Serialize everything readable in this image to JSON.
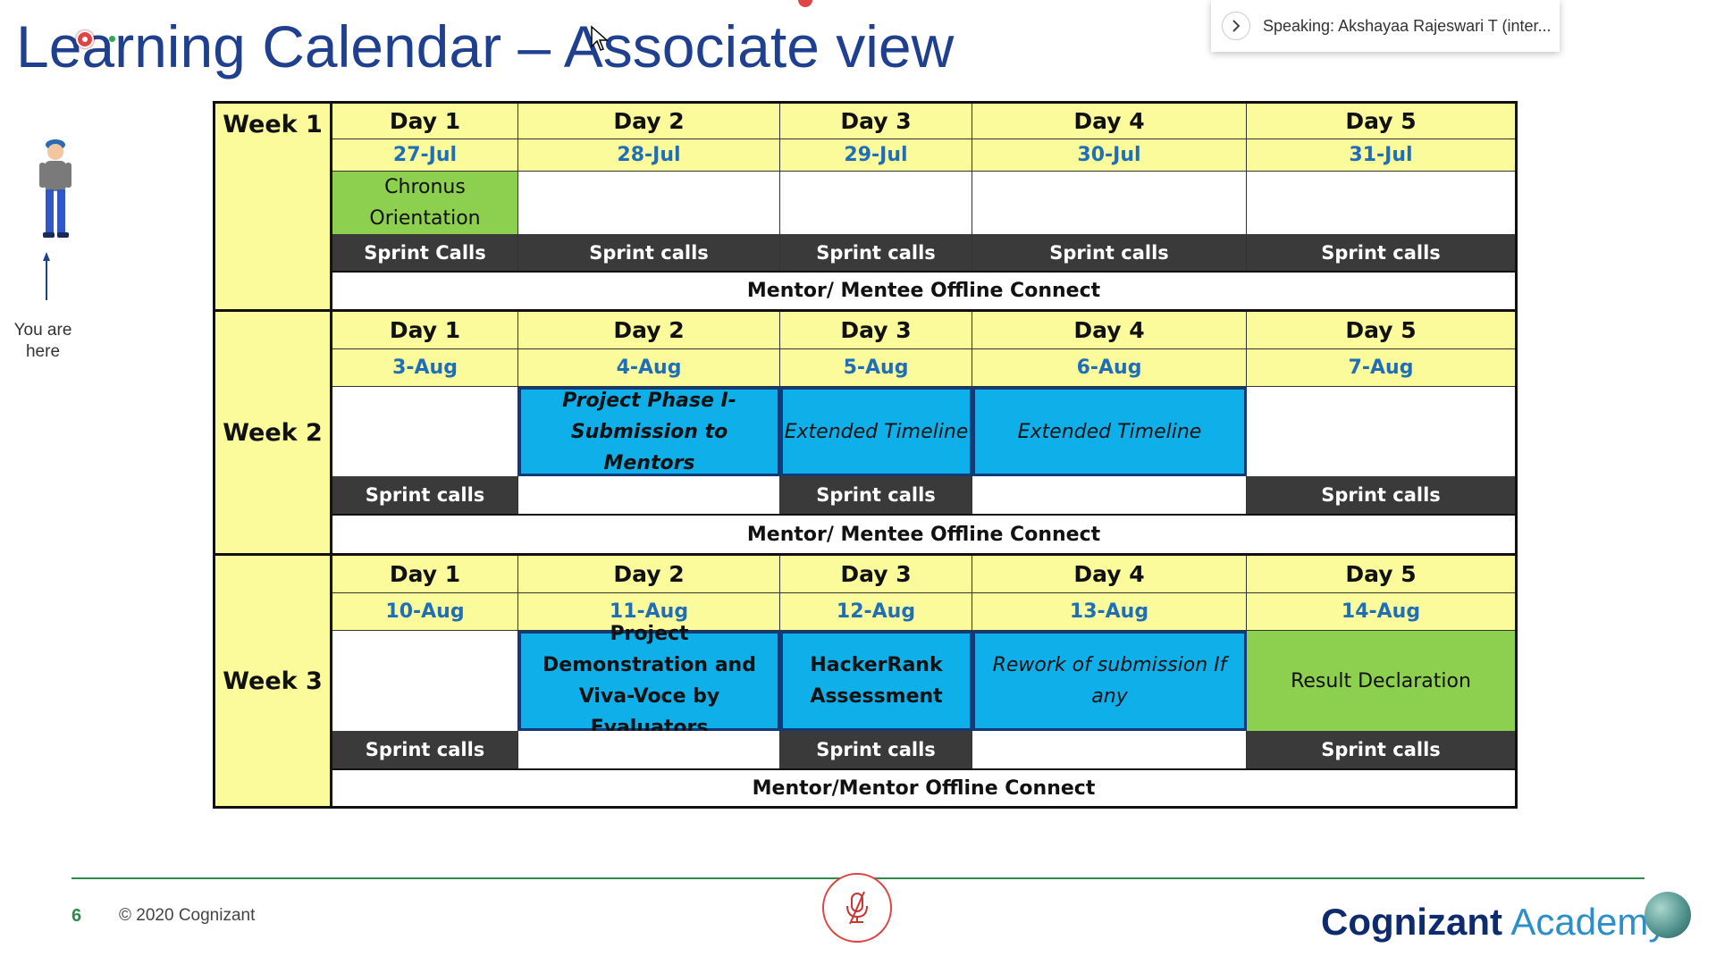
{
  "slide": {
    "title": "Learning Calendar – Associate view",
    "page_number": "6",
    "copyright": "© 2020 Cognizant",
    "brand_primary": "Cognizant",
    "brand_secondary": "Academy",
    "you_are_here": "You are here"
  },
  "overlay": {
    "speaking": "Speaking: Akshayaa Rajeswari T (inter..."
  },
  "calendar": {
    "weeks": [
      {
        "label": "Week 1",
        "days": [
          "Day 1",
          "Day 2",
          "Day 3",
          "Day 4",
          "Day 5"
        ],
        "dates": [
          "27-Jul",
          "28-Jul",
          "29-Jul",
          "30-Jul",
          "31-Jul"
        ],
        "activities": [
          "Chronus Orientation",
          "",
          "",
          "",
          ""
        ],
        "sprints": [
          "Sprint Calls",
          "Sprint calls",
          "Sprint calls",
          "Sprint calls",
          "Sprint calls"
        ],
        "mentor": "Mentor/ Mentee Offline Connect"
      },
      {
        "label": "Week 2",
        "days": [
          "Day 1",
          "Day 2",
          "Day 3",
          "Day 4",
          "Day 5"
        ],
        "dates": [
          "3-Aug",
          "4-Aug",
          "5-Aug",
          "6-Aug",
          "7-Aug"
        ],
        "activities": [
          "",
          "Project Phase I- Submission to Mentors",
          "Extended Timeline",
          "Extended Timeline",
          ""
        ],
        "sprints": [
          "Sprint calls",
          "",
          "Sprint calls",
          "",
          "Sprint calls"
        ],
        "mentor": "Mentor/ Mentee Offline Connect"
      },
      {
        "label": "Week 3",
        "days": [
          "Day 1",
          "Day 2",
          "Day 3",
          "Day 4",
          "Day 5"
        ],
        "dates": [
          "10-Aug",
          "11-Aug",
          "12-Aug",
          "13-Aug",
          "14-Aug"
        ],
        "activities": [
          "",
          "Project Demonstration and Viva-Voce by Evaluators",
          "HackerRank Assessment",
          "Rework of submission If any",
          "Result Declaration"
        ],
        "sprints": [
          "Sprint calls",
          "",
          "Sprint calls",
          "",
          "Sprint calls"
        ],
        "mentor": "Mentor/Mentor Offline Connect"
      }
    ]
  },
  "colors": {
    "title": "#1f3f8f",
    "header_yellow": "#fbfb9c",
    "date_blue": "#1f6fb8",
    "activity_blue": "#0fb0ea",
    "activity_green": "#8dcf4f",
    "sprint_dark": "#3a3a3a"
  },
  "icons": {
    "person": "person-icon",
    "arrow": "arrow-up-icon",
    "mic": "mic-muted-icon",
    "chevron": "chevron-right-icon"
  }
}
